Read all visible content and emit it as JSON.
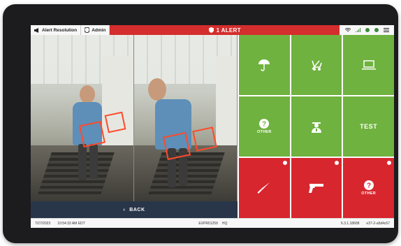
{
  "topbar": {
    "tab_alert_resolution": "Alert Resolution",
    "tab_admin": "Admin",
    "alert_text": "1 ALERT"
  },
  "cameras": {
    "back_label": "BACK"
  },
  "tiles": [
    {
      "icon": "umbrella-icon",
      "label": "",
      "color": "green",
      "flag": false
    },
    {
      "icon": "stroller-icon",
      "label": "",
      "color": "green",
      "flag": false
    },
    {
      "icon": "laptop-icon",
      "label": "",
      "color": "green",
      "flag": false
    },
    {
      "icon": "question-icon",
      "label": "OTHER",
      "color": "green",
      "flag": false
    },
    {
      "icon": "officer-icon",
      "label": "",
      "color": "green",
      "flag": false
    },
    {
      "icon": "",
      "label": "TEST",
      "color": "green",
      "flag": false
    },
    {
      "icon": "knife-icon",
      "label": "",
      "color": "red",
      "flag": true
    },
    {
      "icon": "gun-icon",
      "label": "",
      "color": "red",
      "flag": true
    },
    {
      "icon": "question-icon",
      "label": "OTHER",
      "color": "red",
      "flag": true
    }
  ],
  "statusbar": {
    "date": "7/27/2023",
    "time": "10:54:33 AM EDT",
    "device": "EXPR01259",
    "location": "HQ",
    "version": "6.3.1.18608",
    "build": "e37-2-a5d4c67"
  },
  "colors": {
    "alert_red": "#d42d2d",
    "tile_green": "#6fb23f",
    "tile_red": "#d8262e",
    "back_bar": "#29364a"
  }
}
